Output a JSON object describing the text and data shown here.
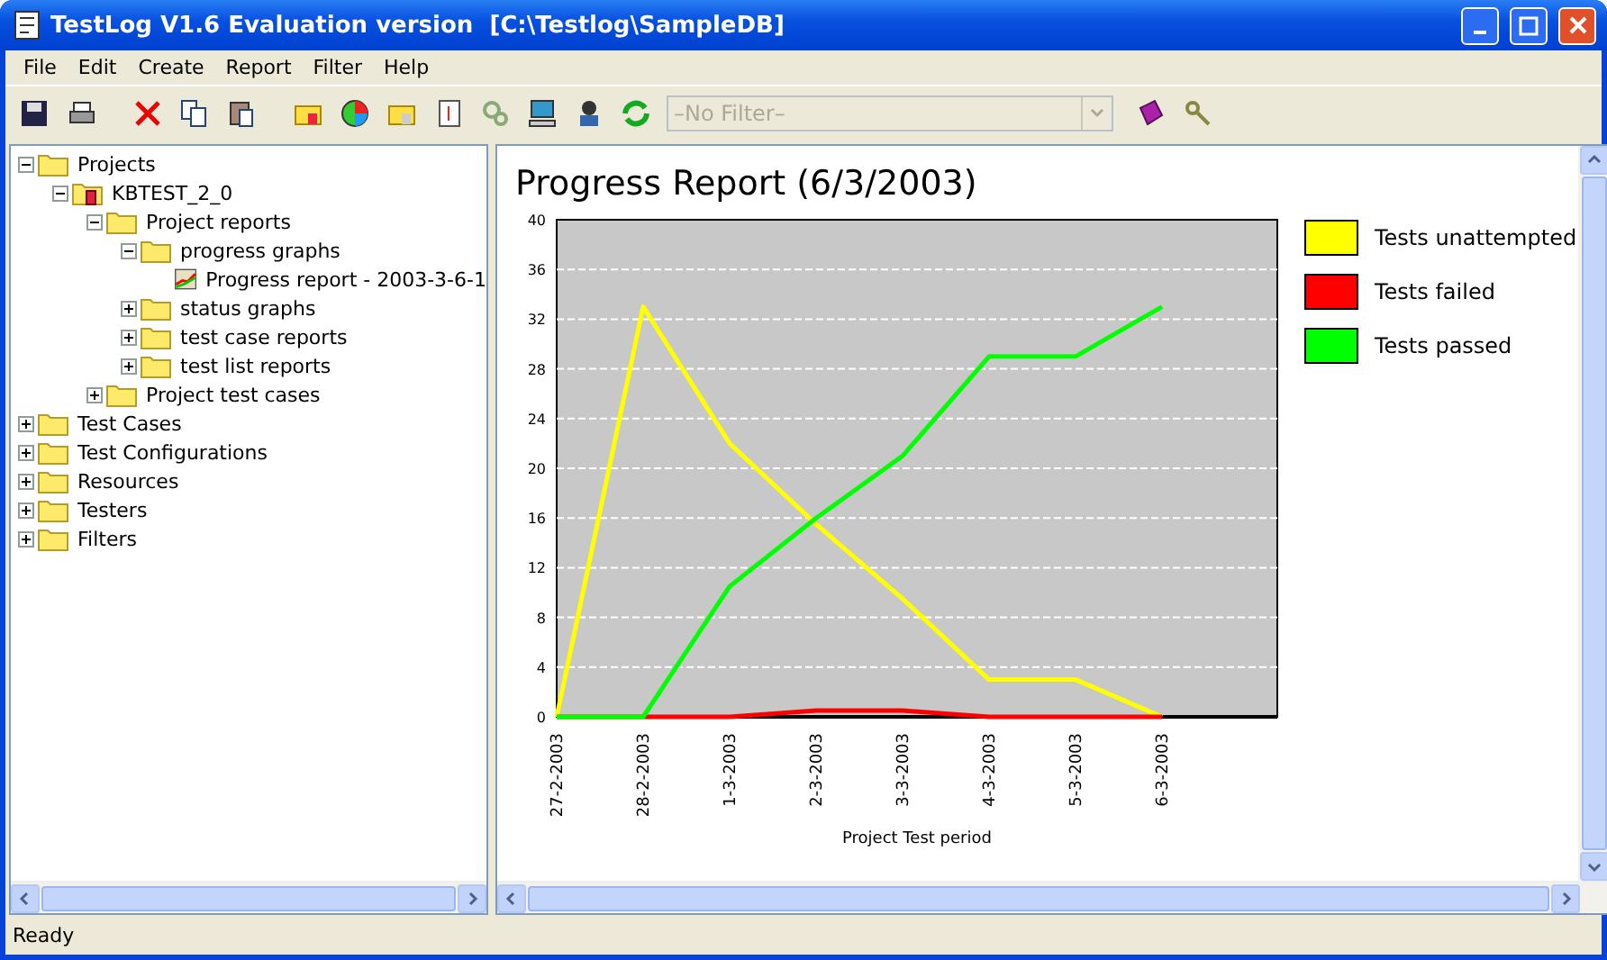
{
  "window": {
    "title": "TestLog V1.6 Evaluation version  [C:\\Testlog\\SampleDB]"
  },
  "menu": [
    "File",
    "Edit",
    "Create",
    "Report",
    "Filter",
    "Help"
  ],
  "filter": {
    "value": "–No Filter–",
    "disabled": true
  },
  "tree": [
    {
      "label": "Projects",
      "kind": "folder",
      "expanded": true,
      "children": [
        {
          "label": "KBTEST_2_0",
          "kind": "project",
          "expanded": true,
          "children": [
            {
              "label": "Project reports",
              "kind": "folder",
              "expanded": true,
              "children": [
                {
                  "label": "progress graphs",
                  "kind": "folder",
                  "expanded": true,
                  "children": [
                    {
                      "label": "Progress report - 2003-3-6-1",
                      "kind": "report"
                    }
                  ]
                },
                {
                  "label": "status graphs",
                  "kind": "folder",
                  "expanded": false
                },
                {
                  "label": "test case reports",
                  "kind": "folder",
                  "expanded": false
                },
                {
                  "label": "test list reports",
                  "kind": "folder",
                  "expanded": false
                }
              ]
            },
            {
              "label": "Project test cases",
              "kind": "folder",
              "expanded": false
            }
          ]
        }
      ]
    },
    {
      "label": "Test Cases",
      "kind": "folder",
      "expanded": false
    },
    {
      "label": "Test Configurations",
      "kind": "folder",
      "expanded": false
    },
    {
      "label": "Resources",
      "kind": "folder",
      "expanded": false
    },
    {
      "label": "Testers",
      "kind": "folder",
      "expanded": false
    },
    {
      "label": "Filters",
      "kind": "folder",
      "expanded": false
    }
  ],
  "report": {
    "title": "Progress Report (6/3/2003)",
    "chart_data": {
      "type": "line",
      "xlabel": "Project Test period",
      "categories": [
        "27-2-2003",
        "28-2-2003",
        "1-3-2003",
        "2-3-2003",
        "3-3-2003",
        "4-3-2003",
        "5-3-2003",
        "6-3-2003"
      ],
      "ylim": [
        0,
        40
      ],
      "yticks": [
        0,
        4,
        8,
        12,
        16,
        20,
        24,
        28,
        32,
        36,
        40
      ],
      "grid": true,
      "legend": true,
      "series": [
        {
          "name": "Tests unattempted",
          "color": "#ffff00",
          "values": [
            0,
            33,
            22,
            15.5,
            9.5,
            3,
            3,
            0
          ]
        },
        {
          "name": "Tests failed",
          "color": "#ff0000",
          "values": [
            0,
            0,
            0,
            0.5,
            0.5,
            0,
            0,
            0
          ]
        },
        {
          "name": "Tests passed",
          "color": "#00ff00",
          "values": [
            0,
            0,
            10.5,
            16,
            21,
            29,
            29,
            33
          ]
        }
      ]
    }
  },
  "status_bar": "Ready"
}
